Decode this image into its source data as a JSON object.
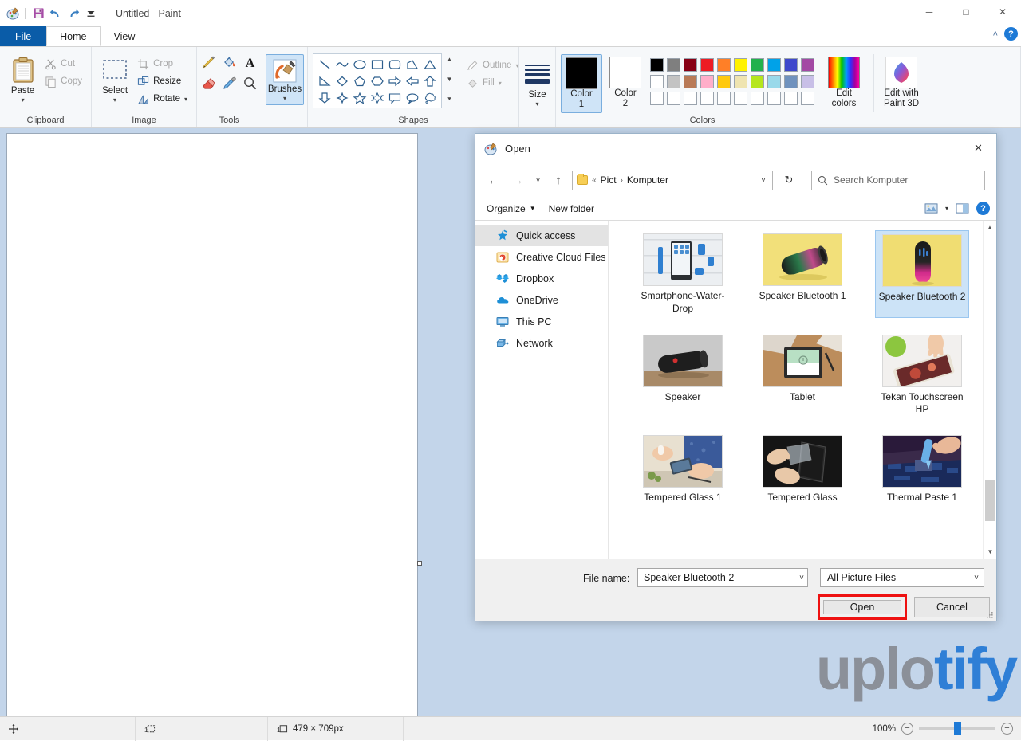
{
  "app": {
    "title": "Untitled - Paint",
    "quick_access": [
      "save-icon",
      "undo-icon",
      "redo-icon",
      "customize-qat-icon"
    ],
    "window_controls": {
      "minimize": "─",
      "maximize": "□",
      "close": "✕"
    },
    "ribbon_collapse": "˄",
    "help": "?"
  },
  "tabs": [
    {
      "label": "File",
      "id": "file"
    },
    {
      "label": "Home",
      "id": "home"
    },
    {
      "label": "View",
      "id": "view"
    }
  ],
  "ribbon": {
    "groups": [
      {
        "label": "Clipboard"
      },
      {
        "label": "Image"
      },
      {
        "label": "Tools"
      },
      {
        "label": "Shapes"
      },
      {
        "label": "Colors"
      }
    ],
    "clipboard": {
      "paste": "Paste",
      "cut": "Cut",
      "copy": "Copy"
    },
    "image": {
      "select": "Select",
      "crop": "Crop",
      "resize": "Resize",
      "rotate": "Rotate"
    },
    "tools": {
      "items": [
        "pencil-icon",
        "fill-bucket-icon",
        "text-icon",
        "eraser-icon",
        "color-picker-icon",
        "magnifier-icon"
      ]
    },
    "brushes": {
      "label": "Brushes"
    },
    "shapes": {
      "row1": [
        "line",
        "curve",
        "oval",
        "rectangle",
        "rounded-rectangle",
        "right-triangle",
        "triangle"
      ],
      "row2": [
        "right-triangle-2",
        "diamond",
        "pentagon",
        "hexagon",
        "right-arrow",
        "left-arrow",
        "up-arrow"
      ],
      "row3": [
        "down-arrow",
        "four-point-star",
        "five-point-star",
        "six-point-star",
        "rect-callout",
        "oval-callout",
        "cloud-callout"
      ],
      "outline": "Outline",
      "fill": "Fill"
    },
    "size": {
      "label": "Size"
    },
    "colors": {
      "color1_label": "Color\n1",
      "color1_line1": "Color",
      "color1_line2": "1",
      "color2_line1": "Color",
      "color2_line2": "2",
      "color1_value": "#000000",
      "color2_value": "#ffffff",
      "edit_colors_line1": "Edit",
      "edit_colors_line2": "colors",
      "paint3d_line1": "Edit with",
      "paint3d_line2": "Paint 3D",
      "palette_row1": [
        "#000000",
        "#7f7f7f",
        "#880015",
        "#ed1c24",
        "#ff7f27",
        "#fff200",
        "#22b14c",
        "#00a2e8",
        "#3f48cc",
        "#a349a4"
      ],
      "palette_row2": [
        "#ffffff",
        "#c3c3c3",
        "#b97a57",
        "#ffaec9",
        "#ffc90e",
        "#efe4b0",
        "#b5e61d",
        "#99d9ea",
        "#7092be",
        "#c8bfe7"
      ],
      "palette_row3": [
        "#ffffff",
        "#ffffff",
        "#ffffff",
        "#ffffff",
        "#ffffff",
        "#ffffff",
        "#ffffff",
        "#ffffff",
        "#ffffff",
        "#ffffff"
      ]
    }
  },
  "statusbar": {
    "cursor_position": "",
    "selection_size": "",
    "image_size": "479 × 709px",
    "zoom_level": "100%",
    "zoom_out": "−",
    "zoom_in": "+"
  },
  "watermark": {
    "part1": "uplo",
    "part2": "tify"
  },
  "dialog": {
    "title": "Open",
    "close": "✕",
    "nav": {
      "back": "←",
      "forward": "→",
      "recent": "˅",
      "up": "↑",
      "refresh": "↻",
      "dropdown": "˅"
    },
    "breadcrumb": {
      "prefix": "«",
      "items": [
        "Pict",
        "Komputer"
      ],
      "separator": "›"
    },
    "search": {
      "placeholder": "Search Komputer",
      "icon": "search-icon"
    },
    "commandbar": {
      "organize": "Organize",
      "new_folder": "New folder",
      "view_icon": "view-layout-icon",
      "view_caret": "▾",
      "preview_pane": "preview-pane-icon",
      "help": "?"
    },
    "sidebar": [
      {
        "label": "Quick access",
        "icon": "star-pin-icon",
        "selected": true
      },
      {
        "label": "Creative Cloud Files",
        "icon": "creative-cloud-icon",
        "selected": false
      },
      {
        "label": "Dropbox",
        "icon": "dropbox-icon",
        "selected": false
      },
      {
        "label": "OneDrive",
        "icon": "onedrive-cloud-icon",
        "selected": false
      },
      {
        "label": "This PC",
        "icon": "this-pc-monitor-icon",
        "selected": false
      },
      {
        "label": "Network",
        "icon": "network-icon",
        "selected": false
      }
    ],
    "files": [
      {
        "name": "Smartphone-Water-Drop",
        "selected": false,
        "thumb": "smartphone-water-drop"
      },
      {
        "name": "Speaker Bluetooth 1",
        "selected": false,
        "thumb": "speaker-bluetooth-1"
      },
      {
        "name": "Speaker Bluetooth 2",
        "selected": true,
        "thumb": "speaker-bluetooth-2"
      },
      {
        "name": "Speaker",
        "selected": false,
        "thumb": "speaker"
      },
      {
        "name": "Tablet",
        "selected": false,
        "thumb": "tablet"
      },
      {
        "name": "Tekan Touchscreen HP",
        "selected": false,
        "thumb": "tekan-touchscreen-hp"
      },
      {
        "name": "Tempered Glass 1",
        "selected": false,
        "thumb": "tempered-glass-1"
      },
      {
        "name": "Tempered Glass",
        "selected": false,
        "thumb": "tempered-glass"
      },
      {
        "name": "Thermal Paste 1",
        "selected": false,
        "thumb": "thermal-paste-1"
      }
    ],
    "footer": {
      "filename_label": "File name:",
      "filename_value": "Speaker Bluetooth 2",
      "filter_value": "All Picture Files",
      "open_button": "Open",
      "cancel_button": "Cancel",
      "caret": "˅"
    },
    "highlight_color": "#ee1111"
  }
}
